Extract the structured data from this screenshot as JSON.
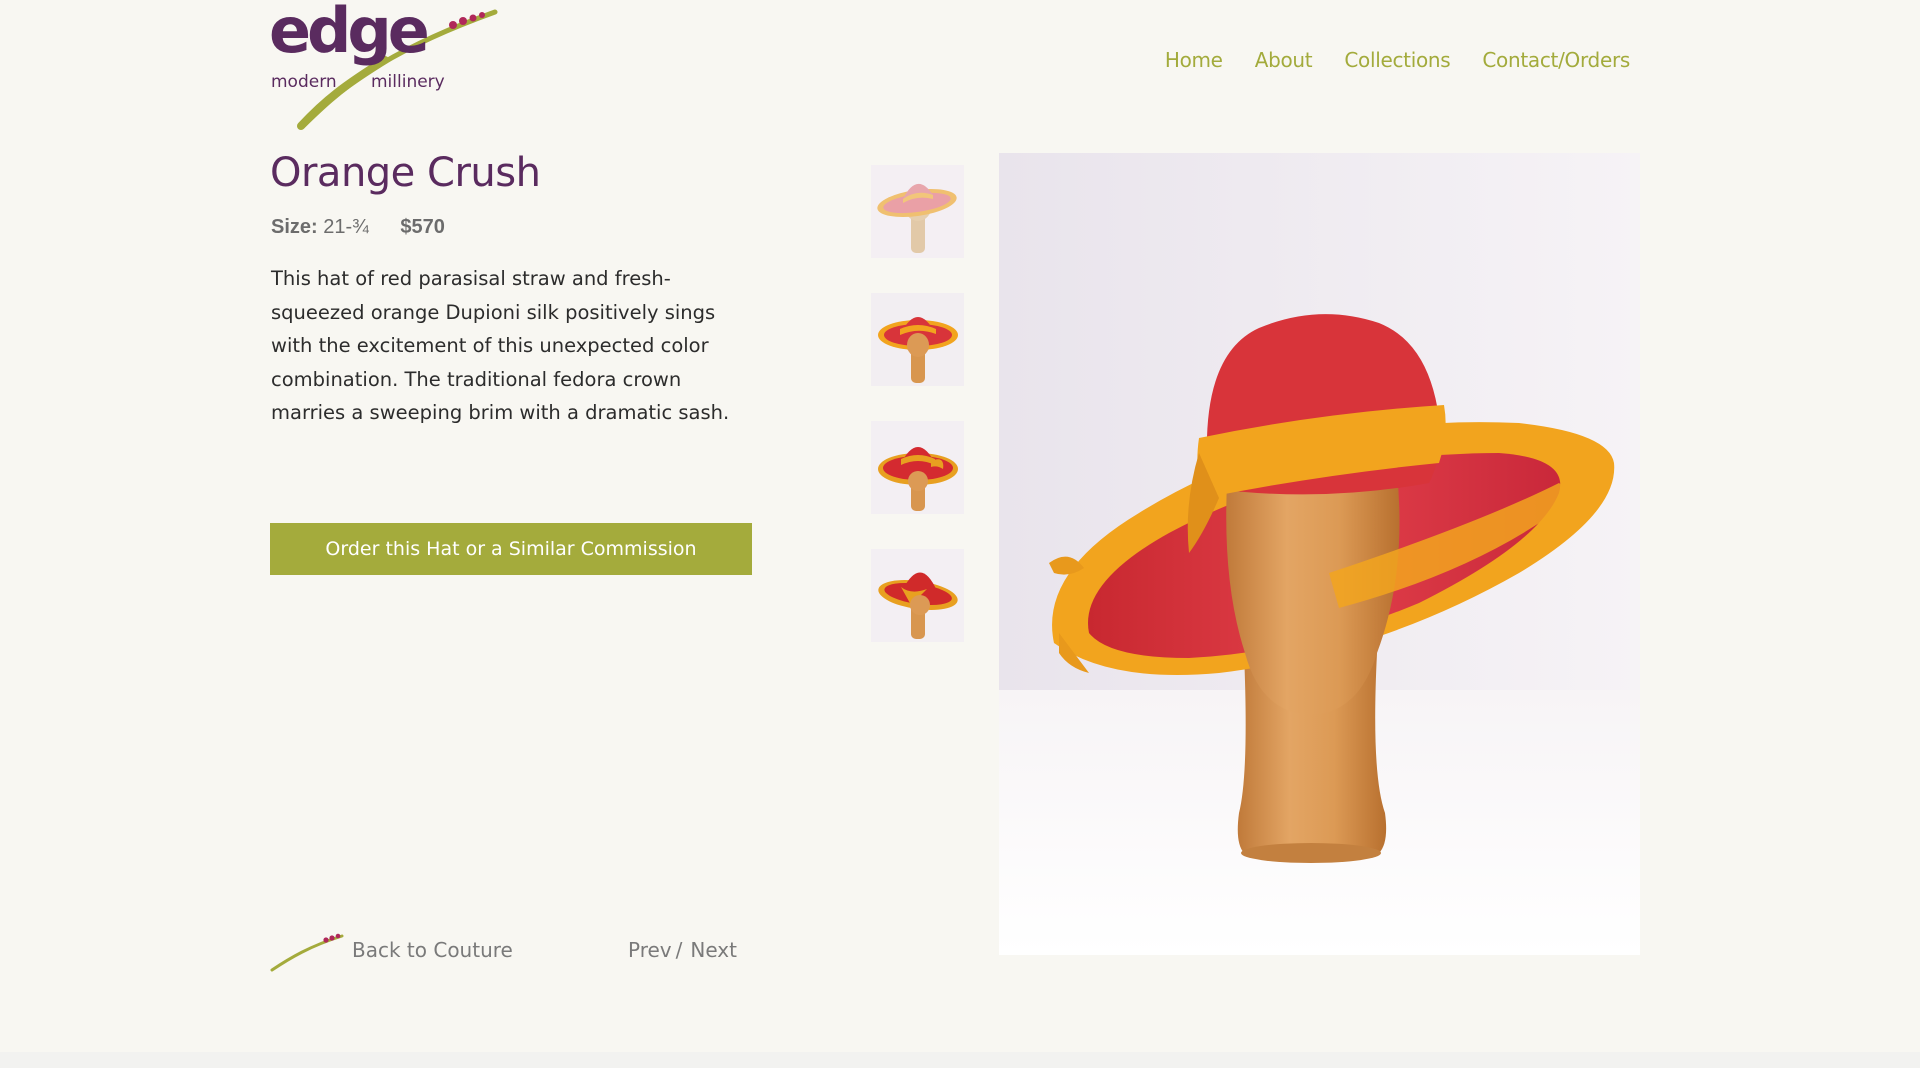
{
  "brand": {
    "name": "edge",
    "sub_left": "modern",
    "sub_right": "millinery",
    "purple": "#5a2b5f",
    "green": "#a4ab3c",
    "dot_color": "#b0285a"
  },
  "nav": {
    "items": [
      "Home",
      "About",
      "Collections",
      "Contact/Orders"
    ]
  },
  "product": {
    "title": "Orange Crush",
    "size_label": "Size:",
    "size_value": "21-¾",
    "price": "$570",
    "description": "This hat of red parasisal straw and fresh-squeezed orange Dupioni silk positively sings with the excitement of this unexpected color combination. The traditional fedora crown marries a sweeping brim with a dramatic sash.",
    "order_button": "Order this Hat or a Similar Commission"
  },
  "footer_nav": {
    "back_label": "Back to Couture",
    "prev_label": "Prev",
    "separator": "/",
    "next_label": "Next"
  },
  "gallery": {
    "thumbnails": [
      {
        "name": "thumb-1",
        "crown": "#e8a0a8",
        "band": "#f0c070"
      },
      {
        "name": "thumb-2",
        "crown": "#d8302a",
        "band": "#f0a020"
      },
      {
        "name": "thumb-3",
        "crown": "#d42a30",
        "band": "#e8a020"
      },
      {
        "name": "thumb-4",
        "crown": "#d02a2a",
        "band": "#e8a020"
      }
    ],
    "main_icon": "hat-on-wooden-mannequin",
    "hat_red": "#d8343a",
    "hat_orange": "#f2a41e",
    "wood": "#d9954e"
  }
}
